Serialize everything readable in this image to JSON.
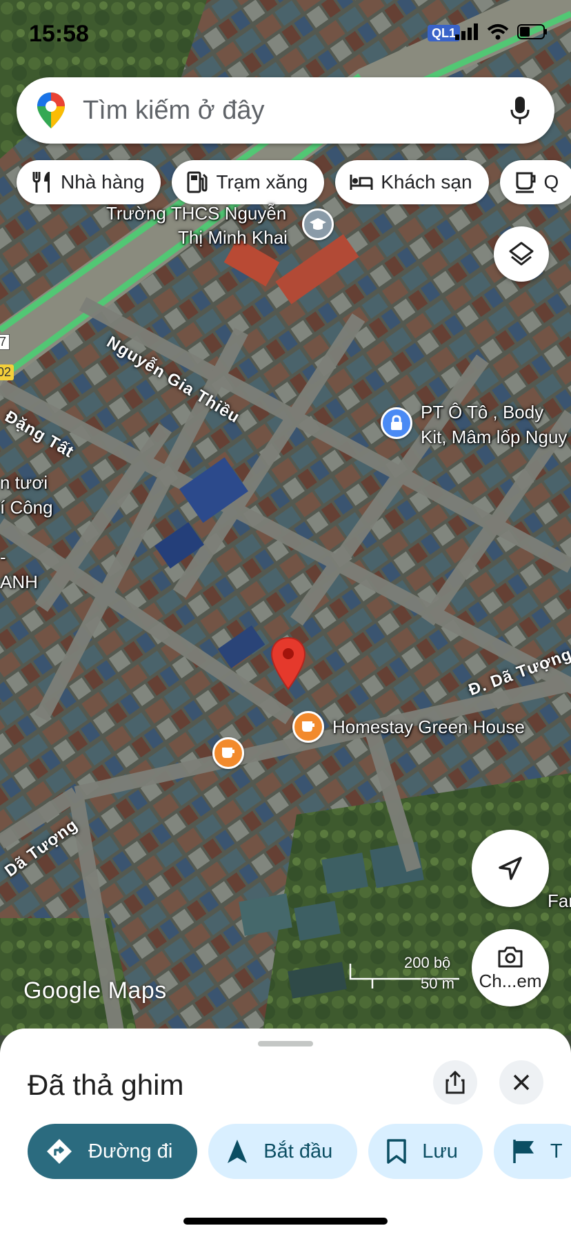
{
  "status_bar": {
    "time": "15:58",
    "badge": "QL1"
  },
  "search": {
    "placeholder": "Tìm kiếm ở đây"
  },
  "chips": [
    {
      "label": "Nhà hàng",
      "icon": "fork-knife-icon"
    },
    {
      "label": "Trạm xăng",
      "icon": "gas-station-icon"
    },
    {
      "label": "Khách sạn",
      "icon": "bed-icon"
    },
    {
      "label": "Q",
      "icon": "coffee-icon"
    }
  ],
  "map": {
    "labels": {
      "school_1": "Trường THCS Nguyễn",
      "school_2": "Thị Minh Khai",
      "street_1": "Nguyễn Gia Thiều",
      "street_2": "Đặng Tất",
      "poi_1": "PT Ô Tô , Body",
      "poi_2": "Kit, Mâm lốp Nguy",
      "left_1": "n tươi",
      "left_2": "í Công",
      "left_3": "-",
      "left_4": "ANH",
      "street_3": "Đ. Dã Tượng",
      "street_4": "Dã Tượng",
      "homestay": "Homestay Green House",
      "right_edge": "Far",
      "road_7": "7",
      "road_02": "02"
    },
    "scale": {
      "imperial": "200 bộ",
      "metric": "50 m"
    },
    "brand": "Google Maps",
    "camera_label": "Ch...em",
    "colors": {
      "pin": "#e5392c",
      "cafe_poi": "#f28a2c",
      "service_poi": "#4a8af4",
      "school_poi": "#8a9ba8"
    }
  },
  "sheet": {
    "title": "Đã thả ghim",
    "actions": [
      {
        "label": "Đường đi",
        "icon": "directions-icon"
      },
      {
        "label": "Bắt đầu",
        "icon": "navigation-arrow-icon"
      },
      {
        "label": "Lưu",
        "icon": "bookmark-icon"
      },
      {
        "label": "T",
        "icon": "flag-icon"
      }
    ]
  }
}
